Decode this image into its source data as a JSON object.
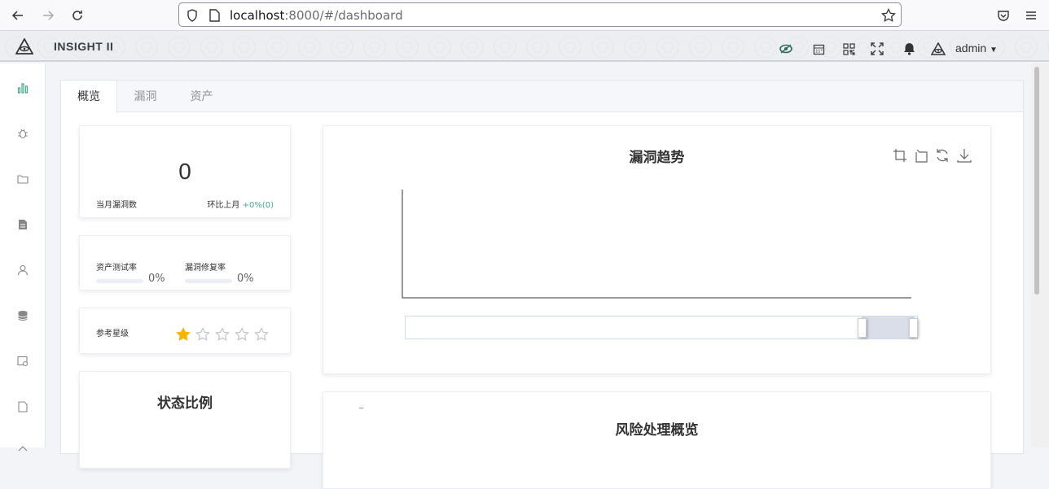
{
  "browser": {
    "url_host": "localhost",
    "url_rest": ":8000/#/dashboard"
  },
  "header": {
    "brand": "INSIGHT II",
    "user": "admin"
  },
  "tabs": [
    {
      "label": "概览"
    },
    {
      "label": "漏洞"
    },
    {
      "label": "资产"
    }
  ],
  "monthly": {
    "count": "0",
    "label": "当月漏洞数",
    "compare_label": "环比上月",
    "compare_value": "+0%(0)"
  },
  "rates": {
    "asset_test_label": "资产测试率",
    "asset_test_value": "0%",
    "asset_test_fraction": 0,
    "vuln_fix_label": "漏洞修复率",
    "vuln_fix_value": "0%",
    "vuln_fix_fraction": 0
  },
  "rating": {
    "label": "参考星级",
    "stars": 1,
    "max": 5
  },
  "status_panel": {
    "title": "状态比例"
  },
  "trend_chart": {
    "title": "漏洞趋势"
  },
  "risk_panel": {
    "title": "风险处理概览"
  },
  "colors": {
    "accent": "#46a98a",
    "star": "#f5b400"
  }
}
